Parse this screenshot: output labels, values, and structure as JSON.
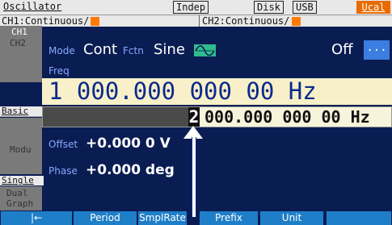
{
  "title_bar": {
    "title": "Oscillator",
    "indep": "Indep",
    "disk": "Disk",
    "usb": "USB",
    "ucal": "Ucal"
  },
  "channel_bar": {
    "ch1": "CH1:Continuous/",
    "ch2": "CH2:Continuous/"
  },
  "sidebar": {
    "ch1": "CH1",
    "ch2": "CH2",
    "basic": "Basic",
    "modu": "Modu",
    "single": "Single",
    "dual_1": "Dual",
    "dual_2": "Graph"
  },
  "main": {
    "mode_label": "Mode",
    "mode_value": "Cont",
    "fctn_label": "Fctn",
    "fctn_value": "Sine",
    "output_state": "Off",
    "more_button": "...",
    "freq_label": "Freq",
    "freq_value": "1 000.000 000 00 Hz",
    "entry_cursor_digit": "2",
    "entry_rest": "000.000 000 00 Hz",
    "offset_label": "Offset",
    "offset_value": "+0.000 0 V",
    "phase_label": "Phase",
    "phase_value": "+0.000 deg"
  },
  "softkeys": {
    "back": "|←",
    "period": "Period",
    "smplrate": "SmplRate",
    "prefix": "Prefix",
    "unit": "Unit"
  },
  "colors": {
    "background": "#0a1d52",
    "accent_orange": "#e86b00",
    "softkey_blue": "#1f7ec8",
    "label_blue": "#8aa7ff",
    "freq_text": "#0b2a8c"
  }
}
